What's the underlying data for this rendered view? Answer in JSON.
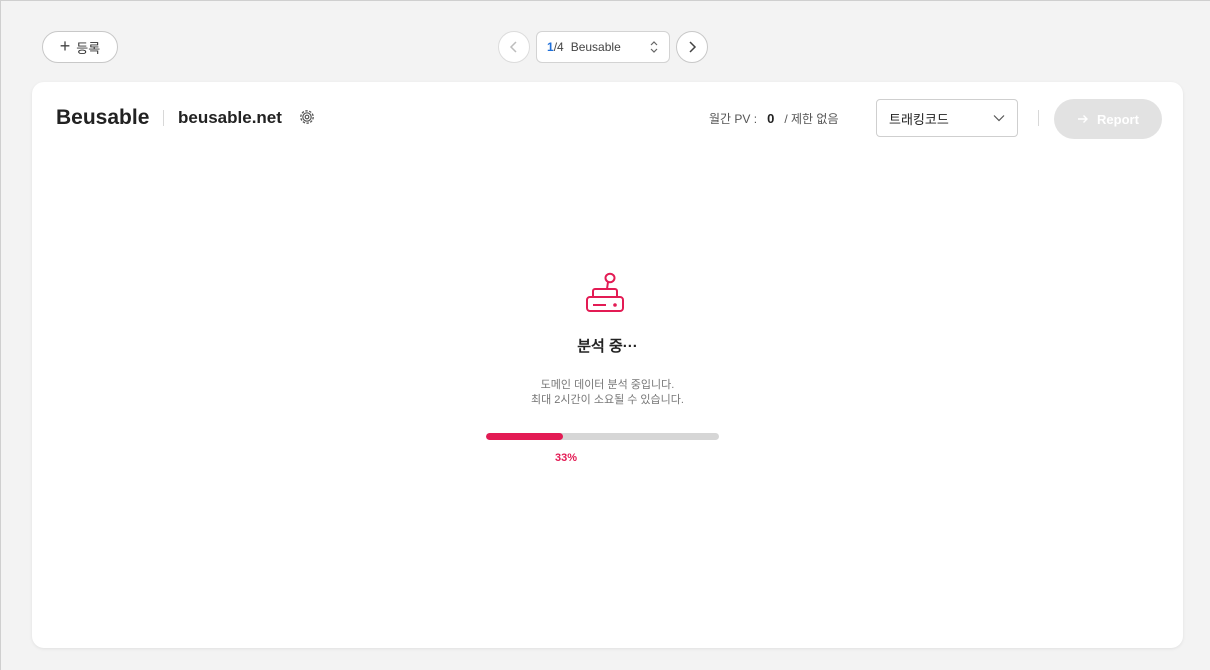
{
  "topbar": {
    "add_label": "등록",
    "pager": {
      "current": "1",
      "total": "/4",
      "site_name": "Beusable"
    }
  },
  "header": {
    "brand": "Beusable",
    "domain": "beusable.net",
    "pv_label": "월간 PV :",
    "pv_value": "0",
    "pv_limit": "/ 제한 없음",
    "tracking_select": "트래킹코드",
    "report_label": "Report"
  },
  "analysis": {
    "title": "분석 중···",
    "desc_line1": "도메인 데이터 분석 중입니다.",
    "desc_line2": "최대 2시간이 소요될 수 있습니다.",
    "progress_percent": 33,
    "progress_label": "33%"
  },
  "colors": {
    "accent": "#e31b54",
    "page_bg": "#f3f3f3",
    "card_bg": "#ffffff",
    "link": "#1e6fd9"
  },
  "icons": [
    "plus-icon",
    "chevron-left-icon",
    "chevron-right-icon",
    "updown-icon",
    "gear-icon",
    "chevron-down-icon",
    "arrow-right-icon",
    "toaster-icon"
  ]
}
